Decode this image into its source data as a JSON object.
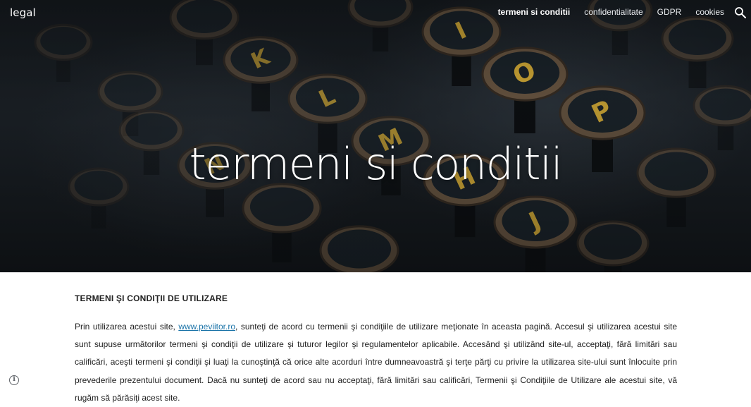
{
  "site": {
    "brand": "legal"
  },
  "nav": {
    "items": [
      {
        "label": "termeni si conditii",
        "active": true
      },
      {
        "label": "confidentialitate",
        "active": false
      },
      {
        "label": "GDPR",
        "active": false
      },
      {
        "label": "cookies",
        "active": false
      }
    ],
    "search_icon": "search-icon"
  },
  "hero": {
    "title": "termeni si conditii",
    "background": "typewriter-keys-photo",
    "key_letters": [
      "I",
      "O",
      "P",
      "H",
      "J",
      "K",
      "L",
      "M",
      "N"
    ]
  },
  "content": {
    "heading": "TERMENI ŞI CONDIŢII DE UTILIZARE",
    "paragraph_before_link": "Prin utilizarea acestui site, ",
    "link_text": "www.peviitor.ro",
    "paragraph_after_link": ", sunteţi de acord cu termenii şi condiţiile de utilizare meţionate în aceasta pagină. Accesul şi utilizarea acestui site sunt supuse următorilor termeni şi condiţii de utilizare şi tuturor legilor şi regulamentelor aplicabile. Accesând şi utilizând site-ul, acceptaţi, fără limitări sau calificări, aceşti termeni şi condiţii şi luaţi la cunoştinţă că orice alte acorduri între dumneavoastră şi terţe părţi cu privire la utilizarea site-ului sunt înlocuite prin prevederile prezentului document. Dacă nu sunteţi de acord sau nu acceptaţi, fără limitări sau calificări, Termenii şi Condiţiile de Utilizare ale acestui site, vă rugăm să părăsiţi acest site."
  },
  "footer": {
    "info_icon": "info-icon",
    "info_glyph": "i"
  },
  "colors": {
    "link": "#1a73a8",
    "accent_key": "#e0b53a"
  }
}
